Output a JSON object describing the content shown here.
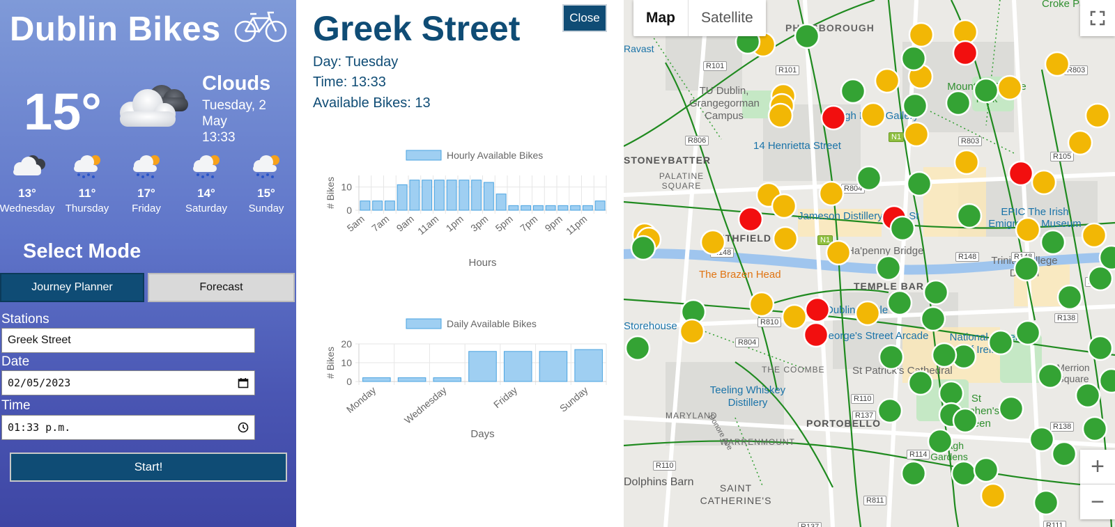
{
  "sidebar": {
    "title": "Dublin Bikes",
    "weather": {
      "temp": "15°",
      "condition": "Clouds",
      "date": "Tuesday, 2 May",
      "time": "13:33"
    },
    "forecast": [
      {
        "temp": "13°",
        "day": "Wednesday",
        "icon": "cloud-icon"
      },
      {
        "temp": "11°",
        "day": "Thursday",
        "icon": "sun-rain-icon"
      },
      {
        "temp": "17°",
        "day": "Friday",
        "icon": "sun-rain-icon"
      },
      {
        "temp": "14°",
        "day": "Saturday",
        "icon": "sun-rain-icon"
      },
      {
        "temp": "15°",
        "day": "Sunday",
        "icon": "sun-rain-icon"
      }
    ],
    "mode_title": "Select Mode",
    "modes": {
      "journey": "Journey Planner",
      "forecast": "Forecast"
    },
    "form": {
      "stations_label": "Stations",
      "station_value": "Greek Street",
      "date_label": "Date",
      "date_value": "02/05/2023",
      "time_label": "Time",
      "time_value": "01:33 p.m.",
      "start": "Start!"
    }
  },
  "panel": {
    "station": "Greek Street",
    "close": "Close",
    "day": "Day: Tuesday",
    "time": "Time: 13:33",
    "bikes": "Available Bikes: 13"
  },
  "chart_data": [
    {
      "type": "bar",
      "legend": "Hourly Available Bikes",
      "xlabel": "Hours",
      "ylabel": "# Bikes",
      "categories": [
        "5am",
        "6am",
        "7am",
        "8am",
        "9am",
        "10am",
        "11am",
        "12pm",
        "1pm",
        "2pm",
        "3pm",
        "4pm",
        "5pm",
        "6pm",
        "7pm",
        "8pm",
        "9pm",
        "10pm",
        "11pm",
        "12am"
      ],
      "tick_labels": [
        "5am",
        "7am",
        "9am",
        "11am",
        "1pm",
        "3pm",
        "5pm",
        "7pm",
        "9pm",
        "11pm"
      ],
      "values": [
        4,
        4,
        4,
        11,
        13,
        13,
        13,
        13,
        13,
        13,
        12,
        7,
        2,
        2,
        2,
        2,
        2,
        2,
        2,
        4
      ],
      "ylim": [
        0,
        15
      ],
      "yticks": [
        0,
        10
      ],
      "color": "#9fcff2",
      "legend_position": "top"
    },
    {
      "type": "bar",
      "legend": "Daily Available Bikes",
      "xlabel": "Days",
      "ylabel": "# Bikes",
      "categories": [
        "Monday",
        "Tuesday",
        "Wednesday",
        "Thursday",
        "Friday",
        "Saturday",
        "Sunday"
      ],
      "tick_labels": [
        "Monday",
        "Wednesday",
        "Friday",
        "Sunday"
      ],
      "values": [
        2,
        2,
        2,
        16,
        16,
        16,
        17
      ],
      "ylim": [
        0,
        20
      ],
      "yticks": [
        0,
        10,
        20
      ],
      "color": "#9fcff2",
      "legend_position": "top"
    }
  ],
  "map": {
    "map_btn": "Map",
    "satellite_btn": "Satellite",
    "zoom_in": "+",
    "zoom_out": "−",
    "labels": {
      "phibsborough": "PHIBSBOROUGH",
      "croke": "Croke Park",
      "tudublin": "TU Dublin, Grangegorman Campus",
      "stoneybatter": "STONEYBATTER",
      "palatine": "PALATINE SQUARE",
      "henrietta": "14 Henrietta Street",
      "hugh": "Hugh Lane Gallery",
      "jameson": "Jameson Distillery Bow St",
      "smithfield": "SMITHFIELD",
      "hapenny": "Ha'penny Bridge",
      "epic": "EPIC The Irish Emigration Museum",
      "brazen": "The Brazen Head",
      "temple": "TEMPLE BAR",
      "trinity": "Trinity College Dublin",
      "storehouse": "Storehouse",
      "dublincastle": "Dublin Castle",
      "georges": "George's Street Arcade",
      "national": "National Gallery of Ireland",
      "coombe": "THE COOMBE",
      "patrick": "St Patrick's Cathedral",
      "teeling": "Teeling Whiskey Distillery",
      "stephens": "St Stephen's Green",
      "maryland": "MARYLAND",
      "warrenmount": "WARRENMOUNT",
      "portobello": "PORTOBELLO",
      "dolphins": "Dolphins Barn",
      "saintcath": "SAINT CATHERINE'S",
      "donore": "Donore Ave",
      "merrion": "Merrion Square",
      "iveagh": "Iveagh Gardens",
      "ravast": "Ravast",
      "mountjoy": "Mountjoy Square Park"
    },
    "roads": [
      "R101",
      "R101",
      "R806",
      "R803",
      "N1",
      "R804",
      "R148",
      "R148",
      "R148",
      "N1",
      "R810",
      "R804",
      "R110",
      "R137",
      "R114",
      "R110",
      "R811",
      "R138",
      "R138",
      "R105",
      "R803",
      "R8",
      "R111",
      "R137"
    ],
    "station_colors": {
      "available": "#34a334",
      "low": "#f2b705",
      "empty": "#f20f0f"
    }
  }
}
